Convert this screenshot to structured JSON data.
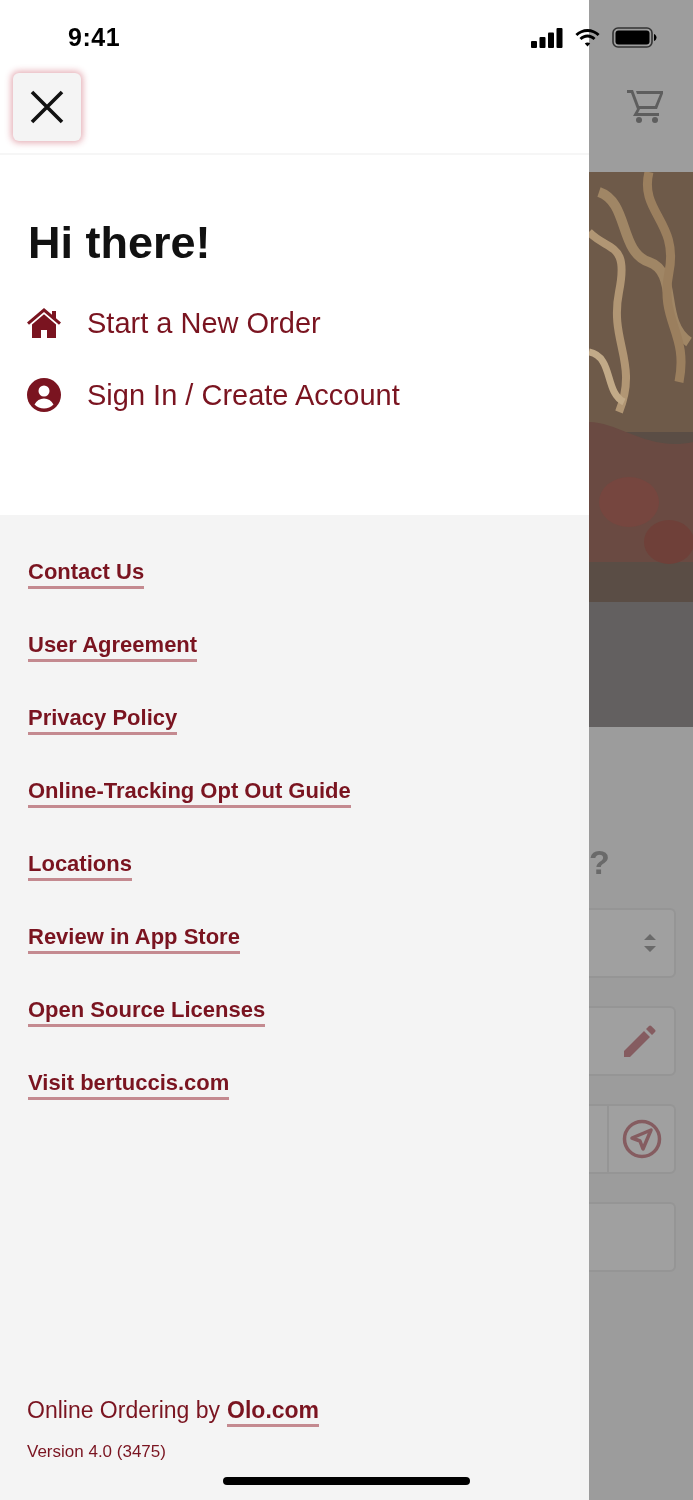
{
  "status_bar": {
    "time": "9:41"
  },
  "drawer": {
    "greeting": "Hi there!",
    "primary_links": [
      {
        "label": "Start a New Order",
        "kind": "home"
      },
      {
        "label": "Sign In / Create Account",
        "kind": "account"
      }
    ],
    "links": [
      "Contact Us",
      "User Agreement",
      "Privacy Policy",
      "Online-Tracking Opt Out Guide",
      "Locations",
      "Review in App Store",
      "Open Source Licenses",
      "Visit bertuccis.com"
    ],
    "footer": {
      "credit_text": "Online Ordering by",
      "credit_link": "Olo.com",
      "version": "Version 4.0 (3475)"
    }
  },
  "background_page": {
    "heading_fragment": "?",
    "fields": [
      {
        "kind": "select"
      },
      {
        "kind": "edit"
      },
      {
        "kind": "locate"
      },
      {
        "kind": "plain"
      }
    ]
  }
}
